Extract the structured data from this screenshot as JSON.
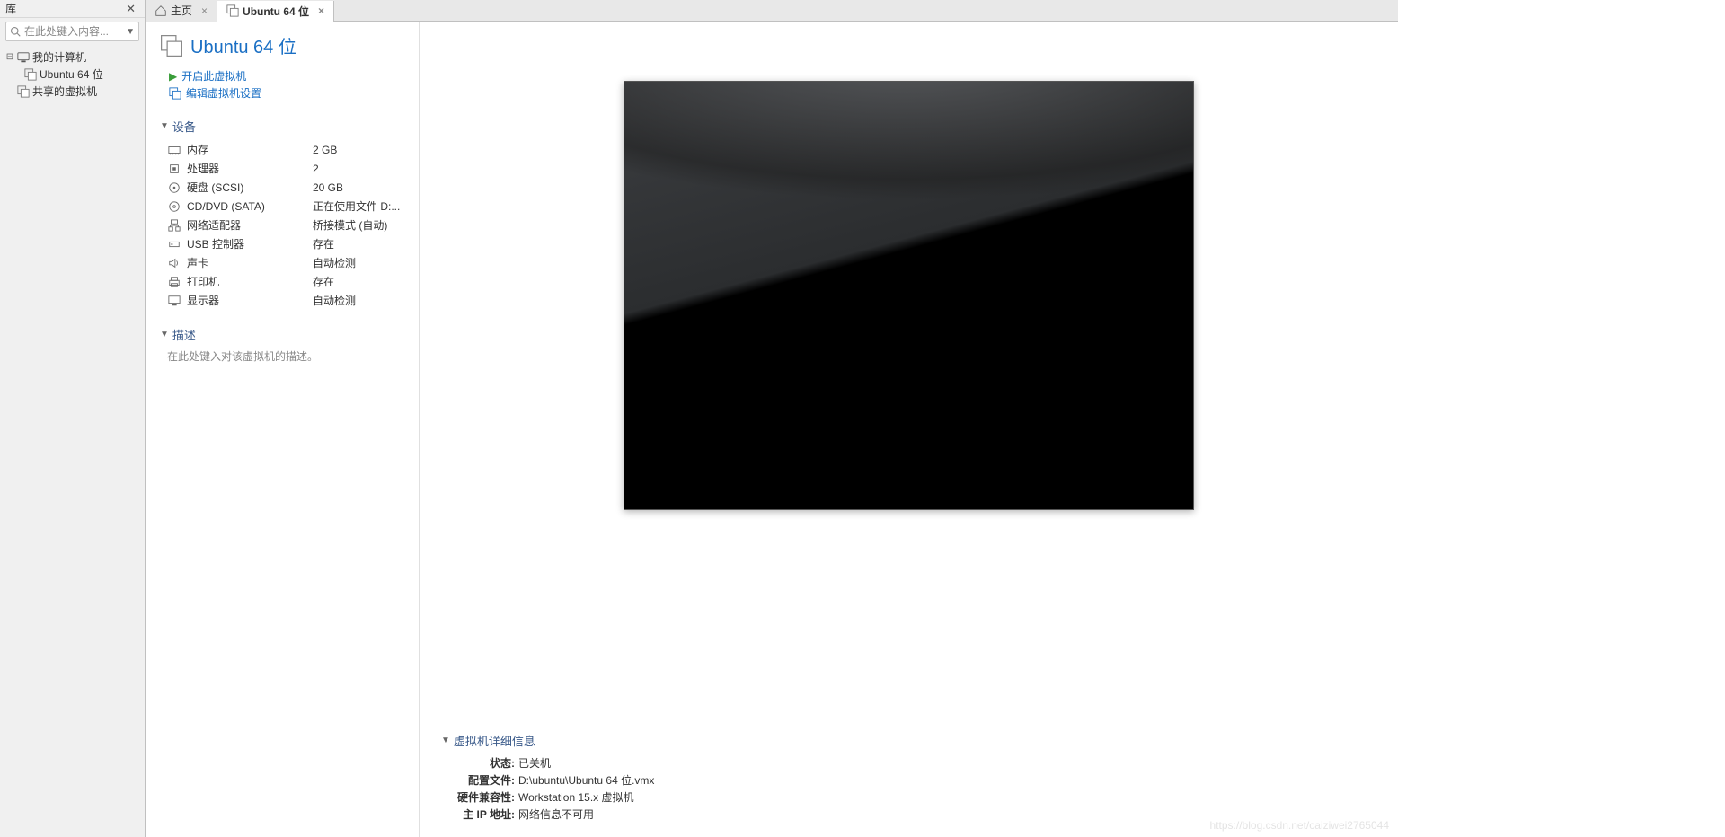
{
  "library": {
    "title": "库",
    "search_placeholder": "在此处键入内容...",
    "tree": {
      "root_label": "我的计算机",
      "child_vm": "Ubuntu 64 位",
      "shared_label": "共享的虚拟机"
    }
  },
  "tabs": {
    "home": "主页",
    "vm": "Ubuntu 64 位"
  },
  "vm": {
    "title": "Ubuntu 64 位",
    "power_on": "开启此虚拟机",
    "edit_settings": "编辑虚拟机设置"
  },
  "sections": {
    "devices": "设备",
    "description": "描述",
    "details": "虚拟机详细信息"
  },
  "devices": {
    "memory_label": "内存",
    "memory_value": "2 GB",
    "cpu_label": "处理器",
    "cpu_value": "2",
    "disk_label": "硬盘 (SCSI)",
    "disk_value": "20 GB",
    "cd_label": "CD/DVD (SATA)",
    "cd_value": "正在使用文件 D:...",
    "net_label": "网络适配器",
    "net_value": "桥接模式 (自动)",
    "usb_label": "USB 控制器",
    "usb_value": "存在",
    "sound_label": "声卡",
    "sound_value": "自动检测",
    "printer_label": "打印机",
    "printer_value": "存在",
    "display_label": "显示器",
    "display_value": "自动检测"
  },
  "description_placeholder": "在此处键入对该虚拟机的描述。",
  "details": {
    "state_label": "状态:",
    "state_value": "已关机",
    "config_label": "配置文件:",
    "config_value": "D:\\ubuntu\\Ubuntu 64 位.vmx",
    "compat_label": "硬件兼容性:",
    "compat_value": "Workstation 15.x 虚拟机",
    "ip_label": "主 IP 地址:",
    "ip_value": "网络信息不可用"
  },
  "watermark": "https://blog.csdn.net/caiziwei2765044"
}
